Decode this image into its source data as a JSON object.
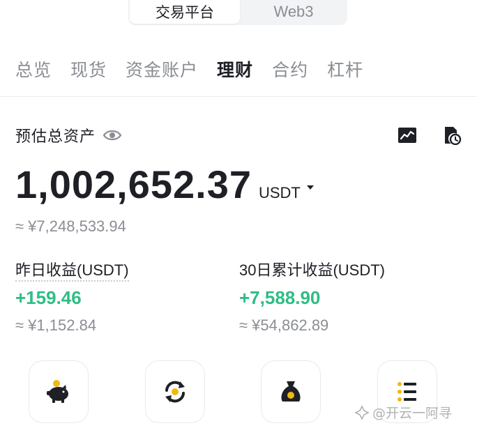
{
  "segments": [
    {
      "label": "交易平台",
      "active": true
    },
    {
      "label": "Web3",
      "active": false
    }
  ],
  "tabs": [
    {
      "label": "总览",
      "active": false
    },
    {
      "label": "现货",
      "active": false
    },
    {
      "label": "资金账户",
      "active": false
    },
    {
      "label": "理财",
      "active": true
    },
    {
      "label": "合约",
      "active": false
    },
    {
      "label": "杠杆",
      "active": false
    }
  ],
  "summary": {
    "label": "预估总资产",
    "amount": "1,002,652.37",
    "unit": "USDT",
    "fiat": "≈ ¥7,248,533.94"
  },
  "stats": {
    "yesterday": {
      "label": "昨日收益(USDT)",
      "value": "+159.46",
      "fiat": "≈ ¥1,152.84"
    },
    "thirty_days": {
      "label": "30日累计收益(USDT)",
      "value": "+7,588.90",
      "fiat": "≈ ¥54,862.89"
    }
  },
  "icons": {
    "chart": "chart-trend-icon",
    "history": "history-icon",
    "eye": "eye-icon",
    "actions": [
      "piggy-bank-icon",
      "exchange-cycle-icon",
      "money-bag-icon",
      "list-icon"
    ]
  },
  "watermark": {
    "text": "@开云一阿寻"
  },
  "colors": {
    "positive": "#2ebd85",
    "accent": "#f0b90b",
    "text": "#1e2026",
    "muted": "#8a8d93"
  }
}
